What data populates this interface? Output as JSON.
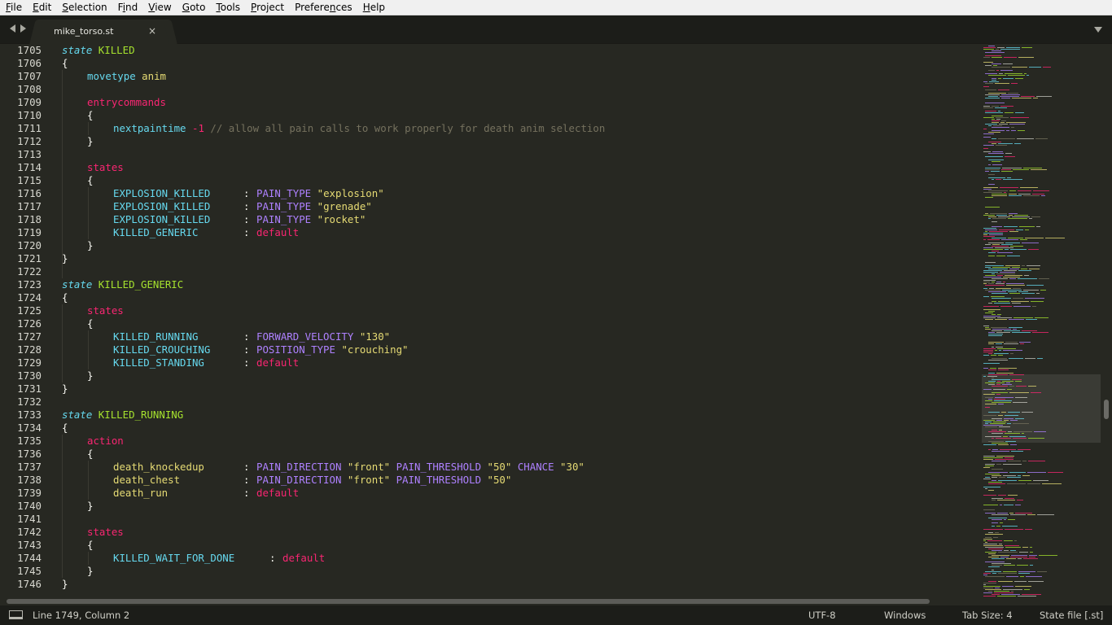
{
  "menu": [
    "File",
    "Edit",
    "Selection",
    "Find",
    "View",
    "Goto",
    "Tools",
    "Project",
    "Preferences",
    "Help"
  ],
  "menu_mnemonics": [
    "F",
    "E",
    "S",
    "i",
    "V",
    "G",
    "T",
    "P",
    "n",
    "H"
  ],
  "tab": {
    "title": "mike_torso.st",
    "close": "×"
  },
  "status": {
    "position": "Line 1749, Column 2",
    "encoding": "UTF-8",
    "line_endings": "Windows",
    "tab_size": "Tab Size: 4",
    "syntax": "State file [.st]"
  },
  "colors": {
    "background": "#272822",
    "keyword": "#66d9ef",
    "state_name": "#a6e22e",
    "section": "#f92672",
    "string": "#e6db74",
    "condition": "#ae81ff",
    "comment": "#75715e"
  },
  "line_numbers": [
    "1705",
    "1706",
    "1707",
    "1708",
    "1709",
    "1710",
    "1711",
    "1712",
    "1713",
    "1714",
    "1715",
    "1716",
    "1717",
    "1718",
    "1719",
    "1720",
    "1721",
    "1722",
    "1723",
    "1724",
    "1725",
    "1726",
    "1727",
    "1728",
    "1729",
    "1730",
    "1731",
    "1732",
    "1733",
    "1734",
    "1735",
    "1736",
    "1737",
    "1738",
    "1739",
    "1740",
    "1741",
    "1742",
    "1743",
    "1744",
    "1745",
    "1746"
  ],
  "code": {
    "l1705": {
      "kw": "state",
      "name": "KILLED"
    },
    "l1706": "{",
    "l1707": {
      "cmd": "movetype",
      "arg": "anim"
    },
    "l1709": "entrycommands",
    "l1710": "{",
    "l1711": {
      "cmd": "nextpaintime",
      "num": "-1",
      "comment": "// allow all pain calls to work properly for death anim selection"
    },
    "l1712": "}",
    "l1714": "states",
    "l1715": "{",
    "l1716": {
      "state": "EXPLOSION_KILLED",
      "sep": ":",
      "cond": "PAIN_TYPE",
      "str": "\"explosion\""
    },
    "l1717": {
      "state": "EXPLOSION_KILLED",
      "sep": ":",
      "cond": "PAIN_TYPE",
      "str": "\"grenade\""
    },
    "l1718": {
      "state": "EXPLOSION_KILLED",
      "sep": ":",
      "cond": "PAIN_TYPE",
      "str": "\"rocket\""
    },
    "l1719": {
      "state": "KILLED_GENERIC",
      "sep": ":",
      "def": "default"
    },
    "l1720": "}",
    "l1721": "}",
    "l1723": {
      "kw": "state",
      "name": "KILLED_GENERIC"
    },
    "l1724": "{",
    "l1725": "states",
    "l1726": "{",
    "l1727": {
      "state": "KILLED_RUNNING",
      "sep": ":",
      "cond": "FORWARD_VELOCITY",
      "str": "\"130\""
    },
    "l1728": {
      "state": "KILLED_CROUCHING",
      "sep": ":",
      "cond": "POSITION_TYPE",
      "str": "\"crouching\""
    },
    "l1729": {
      "state": "KILLED_STANDING",
      "sep": ":",
      "def": "default"
    },
    "l1730": "}",
    "l1731": "}",
    "l1733": {
      "kw": "state",
      "name": "KILLED_RUNNING"
    },
    "l1734": "{",
    "l1735": "action",
    "l1736": "{",
    "l1737": {
      "anim": "death_knockedup",
      "sep": ":",
      "c1": "PAIN_DIRECTION",
      "s1": "\"front\"",
      "c2": "PAIN_THRESHOLD",
      "s2": "\"50\"",
      "c3": "CHANCE",
      "s3": "\"30\""
    },
    "l1738": {
      "anim": "death_chest",
      "sep": ":",
      "c1": "PAIN_DIRECTION",
      "s1": "\"front\"",
      "c2": "PAIN_THRESHOLD",
      "s2": "\"50\""
    },
    "l1739": {
      "anim": "death_run",
      "sep": ":",
      "def": "default"
    },
    "l1740": "}",
    "l1742": "states",
    "l1743": "{",
    "l1744": {
      "state": "KILLED_WAIT_FOR_DONE",
      "sep": ":",
      "def": "default"
    },
    "l1745": "}",
    "l1746": "}"
  }
}
